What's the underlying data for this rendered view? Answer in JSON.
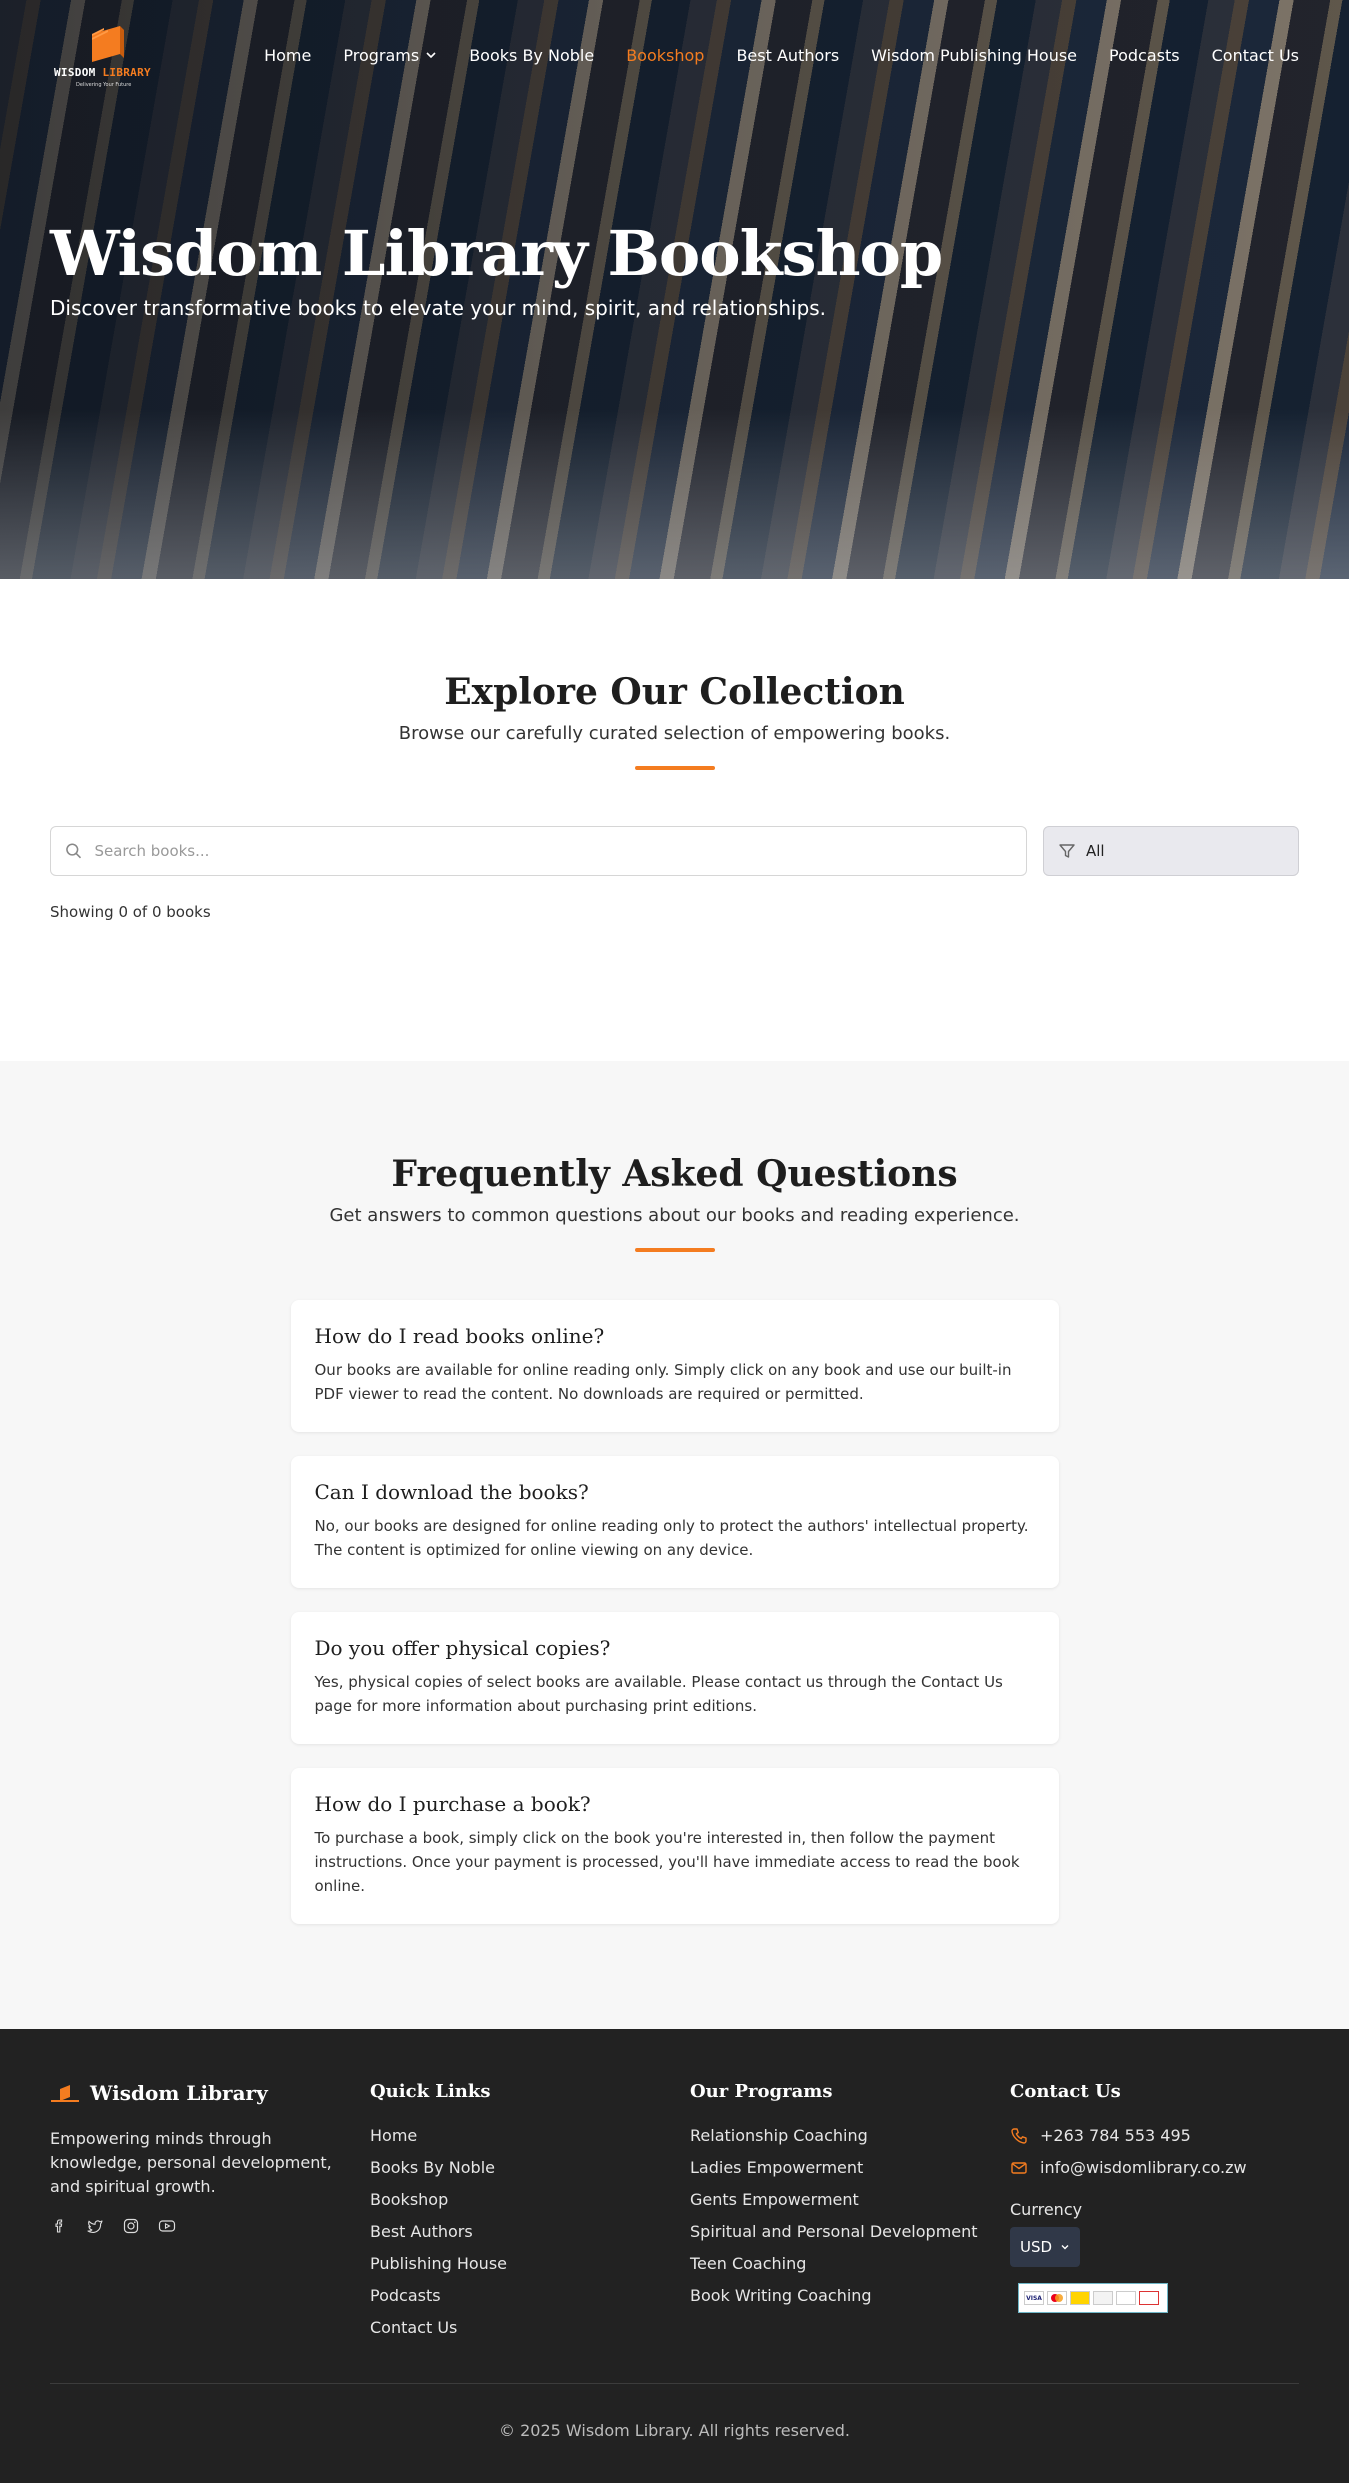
{
  "brand": {
    "word_main": "WISDOM",
    "word_accent": "LIBRARY",
    "tagline": "Delivering Your Future",
    "accent_color": "#f47c20"
  },
  "nav": {
    "items": [
      {
        "label": "Home"
      },
      {
        "label": "Programs",
        "icon": "chevron-down-icon"
      },
      {
        "label": "Books By Noble"
      },
      {
        "label": "Bookshop",
        "active": true
      },
      {
        "label": "Best Authors"
      },
      {
        "label": "Wisdom Publishing House"
      },
      {
        "label": "Podcasts"
      },
      {
        "label": "Contact Us"
      }
    ]
  },
  "hero": {
    "title": "Wisdom Library Bookshop",
    "subtitle": "Discover transformative books to elevate your mind, spirit, and relationships."
  },
  "collection": {
    "title": "Explore Our Collection",
    "subtitle": "Browse our carefully curated selection of empowering books.",
    "search_placeholder": "Search books...",
    "filter_value": "All",
    "count_text": "Showing 0 of 0 books"
  },
  "faq": {
    "title": "Frequently Asked Questions",
    "subtitle": "Get answers to common questions about our books and reading experience.",
    "items": [
      {
        "q": "How do I read books online?",
        "a": "Our books are available for online reading only. Simply click on any book and use our built-in PDF viewer to read the content. No downloads are required or permitted."
      },
      {
        "q": "Can I download the books?",
        "a": "No, our books are designed for online reading only to protect the authors' intellectual property. The content is optimized for online viewing on any device."
      },
      {
        "q": "Do you offer physical copies?",
        "a": "Yes, physical copies of select books are available. Please contact us through the Contact Us page for more information about purchasing print editions."
      },
      {
        "q": "How do I purchase a book?",
        "a": "To purchase a book, simply click on the book you're interested in, then follow the payment instructions. Once your payment is processed, you'll have immediate access to read the book online."
      }
    ]
  },
  "footer": {
    "brand_name": "Wisdom Library",
    "description": "Empowering minds through knowledge, personal development, and spiritual growth.",
    "quick_links_title": "Quick Links",
    "quick_links": [
      "Home",
      "Books By Noble",
      "Bookshop",
      "Best Authors",
      "Publishing House",
      "Podcasts",
      "Contact Us"
    ],
    "programs_title": "Our Programs",
    "programs": [
      "Relationship Coaching",
      "Ladies Empowerment",
      "Gents Empowerment",
      "Spiritual and Personal Development",
      "Teen Coaching",
      "Book Writing Coaching"
    ],
    "contact_title": "Contact Us",
    "phone": "+263 784 553 495",
    "email": "info@wisdomlibrary.co.zw",
    "currency_label": "Currency",
    "currency_value": "USD",
    "copyright": "© 2025 Wisdom Library. All rights reserved."
  }
}
